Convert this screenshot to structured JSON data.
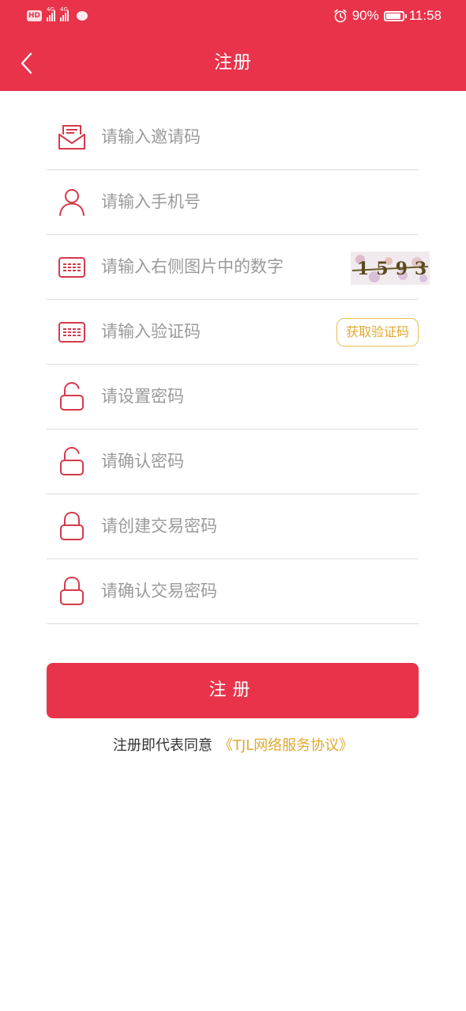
{
  "status_bar": {
    "hd_label": "HD",
    "signal1_tag": "4G",
    "signal2_tag": "4G",
    "battery_percent": "90%",
    "time": "11:58",
    "battery_level": 0.9,
    "icons": [
      "hd-icon",
      "signal-icon",
      "signal-icon",
      "message-icon",
      "alarm-icon",
      "battery-icon"
    ]
  },
  "nav": {
    "title": "注册",
    "back_icon": "chevron-left-icon"
  },
  "form": {
    "fields": [
      {
        "placeholder": "请输入邀请码",
        "icon": "envelope-icon"
      },
      {
        "placeholder": "请输入手机号",
        "icon": "user-icon"
      },
      {
        "placeholder": "请输入右侧图片中的数字",
        "icon": "code-box-icon"
      },
      {
        "placeholder": "请输入验证码",
        "icon": "code-box-icon"
      },
      {
        "placeholder": "请设置密码",
        "icon": "unlock-icon"
      },
      {
        "placeholder": "请确认密码",
        "icon": "unlock-icon"
      },
      {
        "placeholder": "请创建交易密码",
        "icon": "lock-icon"
      },
      {
        "placeholder": "请确认交易密码",
        "icon": "lock-icon"
      }
    ],
    "captcha_text": "1593",
    "sms_button": "获取验证码"
  },
  "submit": {
    "label": "注册"
  },
  "agreement": {
    "prefix": "注册即代表同意",
    "link": "《TJL网络服务协议》"
  },
  "colors": {
    "brand": "#e8334a",
    "accent": "#e1a831"
  }
}
